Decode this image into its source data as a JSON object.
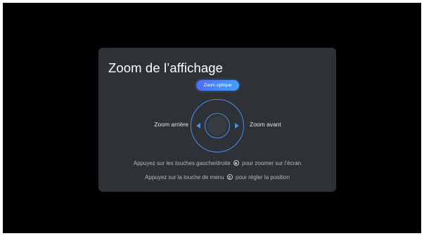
{
  "dialog": {
    "title": "Zoom de l’affichage",
    "mode_label": "Zoom optique",
    "zoom_out_label": "Zoom arrière",
    "zoom_in_label": "Zoom avant",
    "hint_line1_before": "Appuyez sur les touches gauche/droite",
    "hint_line1_icon": "ok-button-icon",
    "hint_line1_after": "pour zoomer sur l’écran",
    "hint_line2_before": "Appuyez sur la touche de menu",
    "hint_line2_icon": "menu-button-icon",
    "hint_line2_after": "pour régler la position"
  },
  "colors": {
    "background": "#000000",
    "dialog": "#2e3136",
    "accent": "#4b8eea",
    "pill_gradient_start": "#4c6cff",
    "pill_gradient_end": "#3fa3ff"
  }
}
